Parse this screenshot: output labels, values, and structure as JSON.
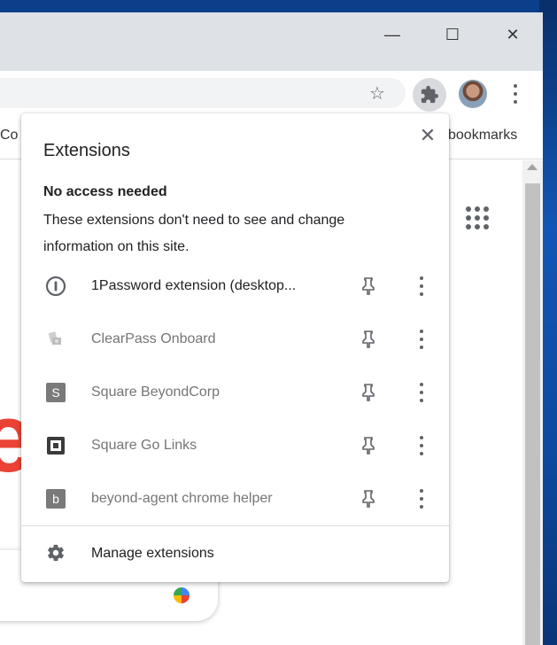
{
  "window": {
    "minimize_glyph": "—",
    "maximize_glyph": "☐",
    "close_glyph": "✕"
  },
  "toolbar": {
    "star_icon": "star-icon",
    "extensions_icon": "puzzle-icon"
  },
  "bookmarks": {
    "left_partial": "Co",
    "right_label": "bookmarks"
  },
  "popup": {
    "title": "Extensions",
    "close_glyph": "✕",
    "section_title": "No access needed",
    "section_description": "These extensions don't need to see and change information on this site.",
    "extensions": [
      {
        "name": "1Password extension (desktop...",
        "icon": "1password-icon",
        "dim": false
      },
      {
        "name": "ClearPass Onboard",
        "icon": "clearpass-icon",
        "dim": true
      },
      {
        "name": "Square BeyondCorp",
        "icon": "square-s-icon",
        "letter": "S",
        "dim": true
      },
      {
        "name": "Square Go Links",
        "icon": "square-go-icon",
        "dim": true
      },
      {
        "name": "beyond-agent chrome helper",
        "icon": "square-b-icon",
        "letter": "b",
        "dim": true
      }
    ],
    "manage_label": "Manage extensions"
  },
  "colors": {
    "accent_red": "#ea4335",
    "text": "#202124",
    "dim_text": "#757575",
    "icon_gray": "#5f6368"
  }
}
